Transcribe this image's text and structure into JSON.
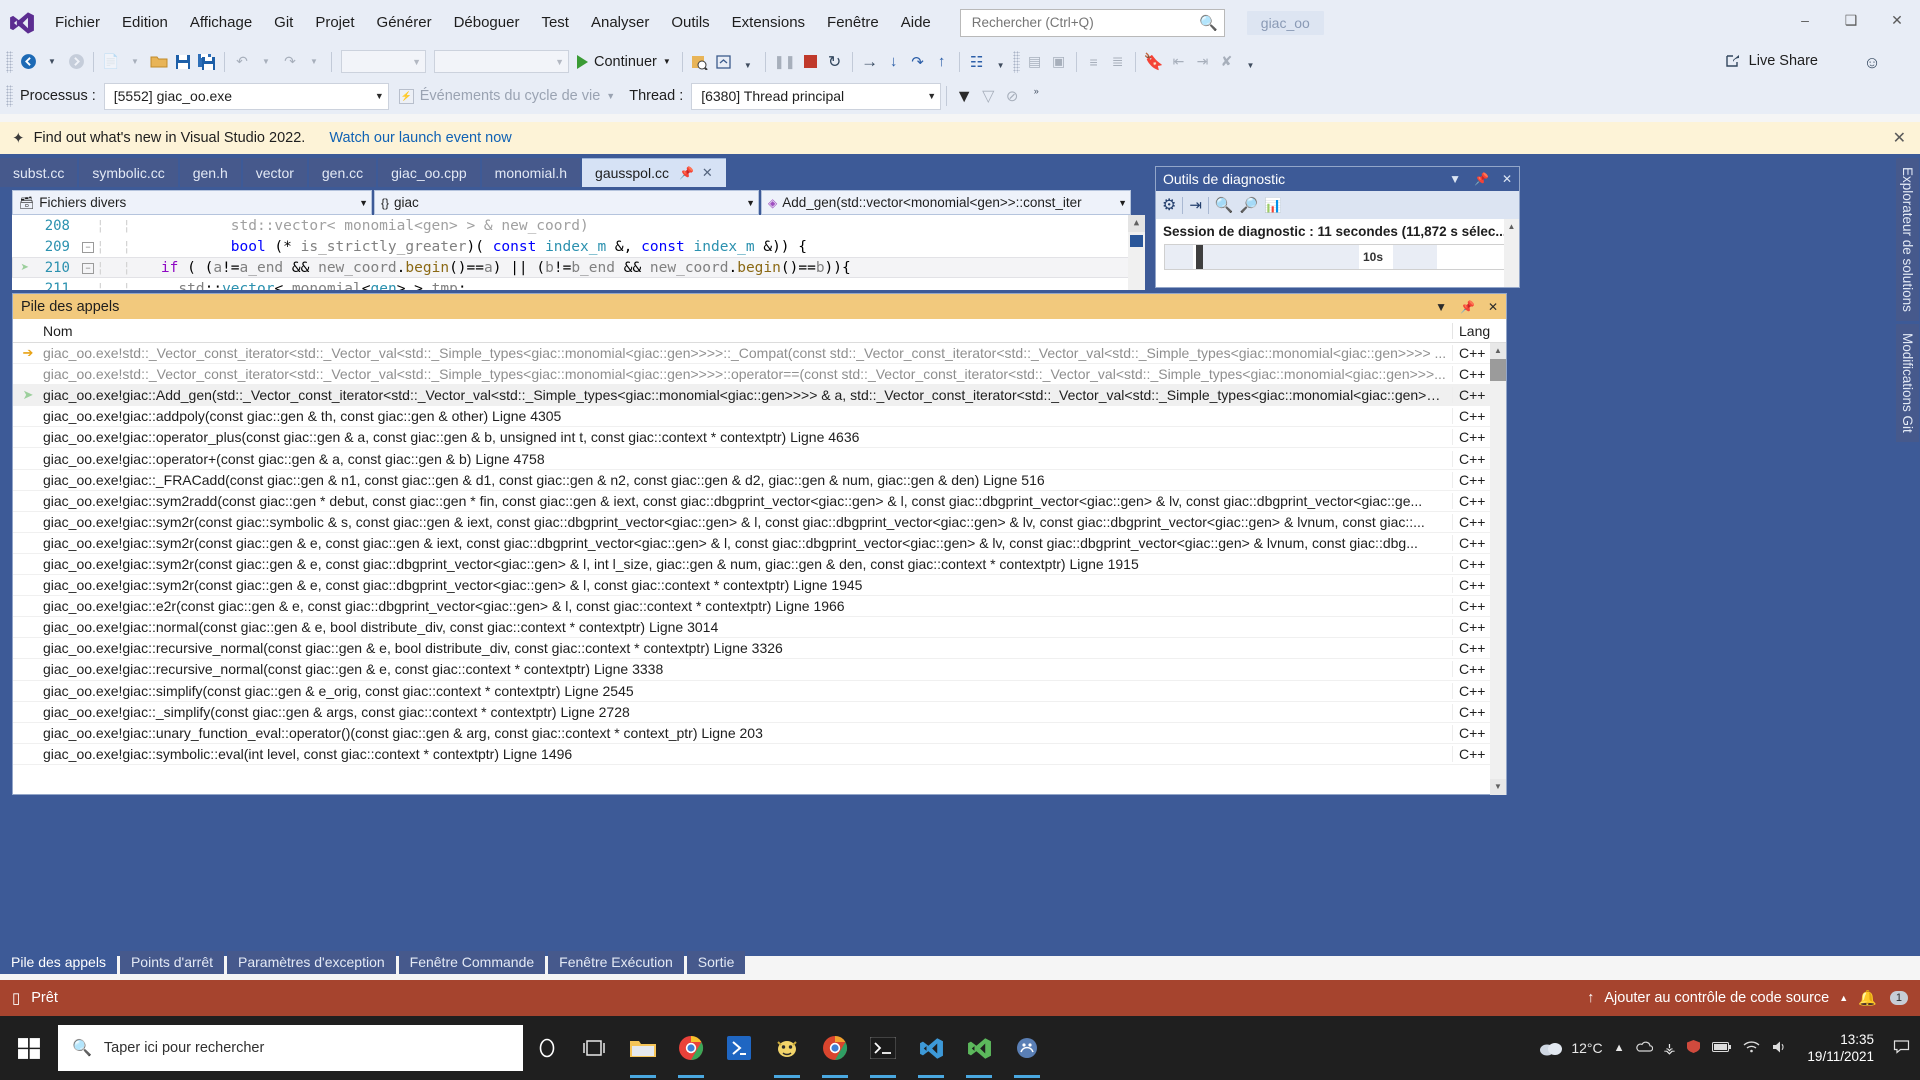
{
  "titlebar": {
    "app_icon": "visual-studio-logo",
    "menus": [
      "Fichier",
      "Edition",
      "Affichage",
      "Git",
      "Projet",
      "Générer",
      "Déboguer",
      "Test",
      "Analyser",
      "Outils",
      "Extensions",
      "Fenêtre",
      "Aide"
    ],
    "search_placeholder": "Rechercher (Ctrl+Q)",
    "search_value": "",
    "solution_name": "giac_oo",
    "minimize": "minimize-icon",
    "restore": "restore-icon",
    "close": "close-icon"
  },
  "toolbar": {
    "continue_label": "Continuer",
    "live_share_label": "Live Share",
    "nav_back": "navigate-back",
    "nav_forward": "navigate-forward",
    "new_item": "new-item",
    "open_file": "open-file",
    "save": "save",
    "save_all": "save-all",
    "undo": "undo",
    "redo": "redo"
  },
  "debugbar": {
    "process_label": "Processus :",
    "process_value": "[5552] giac_oo.exe",
    "lifecycle_label": "Événements du cycle de vie",
    "thread_label": "Thread :",
    "thread_value": "[6380] Thread principal"
  },
  "notice": {
    "text": "Find out what's new in Visual Studio 2022.",
    "link": "Watch our launch event now",
    "close": "close-icon"
  },
  "tabs": {
    "items": [
      "subst.cc",
      "symbolic.cc",
      "gen.h",
      "vector",
      "gen.cc",
      "giac_oo.cpp",
      "monomial.h"
    ],
    "active": "gausspol.cc"
  },
  "navbar": {
    "project": "Fichiers divers",
    "namespace": "giac",
    "member": "Add_gen(std::vector<monomial<gen>>::const_iter"
  },
  "editor": {
    "lines": [
      {
        "number": "208",
        "current": false,
        "tokens": [
          {
            "t": "            ",
            "c": "k-black"
          },
          {
            "t": "std::vector< monomial<gen> > & new_coord)",
            "c": "k-gray"
          }
        ]
      },
      {
        "number": "209",
        "current": false,
        "fold": "-",
        "tokens": [
          {
            "t": "            ",
            "c": "k-black"
          },
          {
            "t": "bool",
            "c": "k-blue"
          },
          {
            "t": " (* ",
            "c": "k-black"
          },
          {
            "t": "is_strictly_greater",
            "c": "k-dgray"
          },
          {
            "t": ")( ",
            "c": "k-black"
          },
          {
            "t": "const",
            "c": "k-blue"
          },
          {
            "t": " ",
            "c": "k-black"
          },
          {
            "t": "index_m",
            "c": "k-teal"
          },
          {
            "t": " &, ",
            "c": "k-black"
          },
          {
            "t": "const",
            "c": "k-blue"
          },
          {
            "t": " ",
            "c": "k-black"
          },
          {
            "t": "index_m",
            "c": "k-teal"
          },
          {
            "t": " &)) {",
            "c": "k-black"
          }
        ]
      },
      {
        "number": "210",
        "current": true,
        "fold": "-",
        "indicator": "current-statement",
        "tokens": [
          {
            "t": "    ",
            "c": "k-black"
          },
          {
            "t": "if",
            "c": "k-purple"
          },
          {
            "t": " ( (",
            "c": "k-black"
          },
          {
            "t": "a",
            "c": "k-dgray"
          },
          {
            "t": "!=",
            "c": "k-black"
          },
          {
            "t": "a_end",
            "c": "k-dgray"
          },
          {
            "t": " && ",
            "c": "k-black"
          },
          {
            "t": "new_coord",
            "c": "k-dgray"
          },
          {
            "t": ".",
            "c": "k-black"
          },
          {
            "t": "begin",
            "c": "k-brown"
          },
          {
            "t": "()",
            "c": "k-black"
          },
          {
            "t": "==",
            "c": "k-black"
          },
          {
            "t": "a",
            "c": "k-dgray"
          },
          {
            "t": ") || (",
            "c": "k-black"
          },
          {
            "t": "b",
            "c": "k-dgray"
          },
          {
            "t": "!=",
            "c": "k-black"
          },
          {
            "t": "b_end",
            "c": "k-dgray"
          },
          {
            "t": " && ",
            "c": "k-black"
          },
          {
            "t": "new_coord",
            "c": "k-dgray"
          },
          {
            "t": ".",
            "c": "k-black"
          },
          {
            "t": "begin",
            "c": "k-brown"
          },
          {
            "t": "()",
            "c": "k-black"
          },
          {
            "t": "==",
            "c": "k-black"
          },
          {
            "t": "b",
            "c": "k-dgray"
          },
          {
            "t": ")){",
            "c": "k-black"
          }
        ]
      },
      {
        "number": "211",
        "current": false,
        "tokens": [
          {
            "t": "      ",
            "c": "k-black"
          },
          {
            "t": "std",
            "c": "k-dgray"
          },
          {
            "t": "::",
            "c": "k-black"
          },
          {
            "t": "vector",
            "c": "k-teal"
          },
          {
            "t": "< ",
            "c": "k-black"
          },
          {
            "t": "monomial",
            "c": "k-dgray"
          },
          {
            "t": "<",
            "c": "k-black"
          },
          {
            "t": "gen",
            "c": "k-teal"
          },
          {
            "t": "> > ",
            "c": "k-black"
          },
          {
            "t": "tmp",
            "c": "k-dgray"
          },
          {
            "t": ";",
            "c": "k-black"
          }
        ]
      }
    ]
  },
  "callstack": {
    "title": "Pile des appels",
    "columns": [
      "Nom",
      "Lang"
    ],
    "rows": [
      {
        "indicator": "current-arrow",
        "dim": true,
        "name": "giac_oo.exe!std::_Vector_const_iterator<std::_Vector_val<std::_Simple_types<giac::monomial<giac::gen>>>>::_Compat(const std::_Vector_const_iterator<std::_Vector_val<std::_Simple_types<giac::monomial<giac::gen>>>> ...",
        "lang": "C++"
      },
      {
        "indicator": "",
        "dim": true,
        "name": "giac_oo.exe!std::_Vector_const_iterator<std::_Vector_val<std::_Simple_types<giac::monomial<giac::gen>>>>::operator==(const std::_Vector_const_iterator<std::_Vector_val<std::_Simple_types<giac::monomial<giac::gen>>>...",
        "lang": "C++"
      },
      {
        "indicator": "current-statement",
        "dim": false,
        "highlight": true,
        "name": "giac_oo.exe!giac::Add_gen(std::_Vector_const_iterator<std::_Vector_val<std::_Simple_types<giac::monomial<giac::gen>>>> & a, std::_Vector_const_iterator<std::_Vector_val<std::_Simple_types<giac::monomial<giac::gen>>>...",
        "lang": "C++"
      },
      {
        "indicator": "",
        "dim": false,
        "name": "giac_oo.exe!giac::addpoly(const giac::gen & th, const giac::gen & other) Ligne 4305",
        "lang": "C++"
      },
      {
        "indicator": "",
        "dim": false,
        "name": "giac_oo.exe!giac::operator_plus(const giac::gen & a, const giac::gen & b, unsigned int t, const giac::context * contextptr) Ligne 4636",
        "lang": "C++"
      },
      {
        "indicator": "",
        "dim": false,
        "name": "giac_oo.exe!giac::operator+(const giac::gen & a, const giac::gen & b) Ligne 4758",
        "lang": "C++"
      },
      {
        "indicator": "",
        "dim": false,
        "name": "giac_oo.exe!giac::_FRACadd(const giac::gen & n1, const giac::gen & d1, const giac::gen & n2, const giac::gen & d2, giac::gen & num, giac::gen & den) Ligne 516",
        "lang": "C++"
      },
      {
        "indicator": "",
        "dim": false,
        "name": "giac_oo.exe!giac::sym2radd(const giac::gen * debut, const giac::gen * fin, const giac::gen & iext, const giac::dbgprint_vector<giac::gen> & l, const giac::dbgprint_vector<giac::gen> & lv, const giac::dbgprint_vector<giac::ge...",
        "lang": "C++"
      },
      {
        "indicator": "",
        "dim": false,
        "name": "giac_oo.exe!giac::sym2r(const giac::symbolic & s, const giac::gen & iext, const giac::dbgprint_vector<giac::gen> & l, const giac::dbgprint_vector<giac::gen> & lv, const giac::dbgprint_vector<giac::gen> & lvnum, const giac::...",
        "lang": "C++"
      },
      {
        "indicator": "",
        "dim": false,
        "name": "giac_oo.exe!giac::sym2r(const giac::gen & e, const giac::gen & iext, const giac::dbgprint_vector<giac::gen> & l, const giac::dbgprint_vector<giac::gen> & lv, const giac::dbgprint_vector<giac::gen> & lvnum, const giac::dbg...",
        "lang": "C++"
      },
      {
        "indicator": "",
        "dim": false,
        "name": "giac_oo.exe!giac::sym2r(const giac::gen & e, const giac::dbgprint_vector<giac::gen> & l, int l_size, giac::gen & num, giac::gen & den, const giac::context * contextptr) Ligne 1915",
        "lang": "C++"
      },
      {
        "indicator": "",
        "dim": false,
        "name": "giac_oo.exe!giac::sym2r(const giac::gen & e, const giac::dbgprint_vector<giac::gen> & l, const giac::context * contextptr) Ligne 1945",
        "lang": "C++"
      },
      {
        "indicator": "",
        "dim": false,
        "name": "giac_oo.exe!giac::e2r(const giac::gen & e, const giac::dbgprint_vector<giac::gen> & l, const giac::context * contextptr) Ligne 1966",
        "lang": "C++"
      },
      {
        "indicator": "",
        "dim": false,
        "name": "giac_oo.exe!giac::normal(const giac::gen & e, bool distribute_div, const giac::context * contextptr) Ligne 3014",
        "lang": "C++"
      },
      {
        "indicator": "",
        "dim": false,
        "name": "giac_oo.exe!giac::recursive_normal(const giac::gen & e, bool distribute_div, const giac::context * contextptr) Ligne 3326",
        "lang": "C++"
      },
      {
        "indicator": "",
        "dim": false,
        "name": "giac_oo.exe!giac::recursive_normal(const giac::gen & e, const giac::context * contextptr) Ligne 3338",
        "lang": "C++"
      },
      {
        "indicator": "",
        "dim": false,
        "name": "giac_oo.exe!giac::simplify(const giac::gen & e_orig, const giac::context * contextptr) Ligne 2545",
        "lang": "C++"
      },
      {
        "indicator": "",
        "dim": false,
        "name": "giac_oo.exe!giac::_simplify(const giac::gen & args, const giac::context * contextptr) Ligne 2728",
        "lang": "C++"
      },
      {
        "indicator": "",
        "dim": false,
        "name": "giac_oo.exe!giac::unary_function_eval::operator()(const giac::gen & arg, const giac::context * context_ptr) Ligne 203",
        "lang": "C++"
      },
      {
        "indicator": "",
        "dim": false,
        "name": "giac_oo.exe!giac::symbolic::eval(int level, const giac::context * contextptr) Ligne 1496",
        "lang": "C++"
      }
    ]
  },
  "diagnostics": {
    "title": "Outils de diagnostic",
    "session_text": "Session de diagnostic : 11 secondes (11,872 s sélec...",
    "timeline_label": "10s",
    "toolbar_icons": [
      "gear-icon",
      "export-icon",
      "zoom-in-icon",
      "zoom-out-icon",
      "chart-icon"
    ]
  },
  "vertical_tabs": [
    "Explorateur de solutions",
    "Modifications Git"
  ],
  "bottom_tabs": {
    "items": [
      "Pile des appels",
      "Points d'arrêt",
      "Paramètres d'exception",
      "Fenêtre Commande",
      "Fenêtre Exécution",
      "Sortie"
    ],
    "active": "Pile des appels"
  },
  "statusbar": {
    "state": "Prêt",
    "source_control": "Ajouter au contrôle de code source",
    "notification_count": "1"
  },
  "taskbar": {
    "search_placeholder": "Taper ici pour rechercher",
    "weather_temp": "12°C",
    "time": "13:35",
    "date": "19/11/2021",
    "apps": [
      "cortana-icon",
      "task-view-icon",
      "file-explorer-icon",
      "chrome-icon",
      "powershell-icon",
      "xaringan-icon",
      "chrome-canary-icon",
      "terminal-icon",
      "vscode-icon",
      "vscode-insiders-icon",
      "giac-icon"
    ]
  },
  "colors": {
    "title_bg": "#e8edf6",
    "chrome_blue": "#3d5a97",
    "tab_inactive": "#46598c",
    "notice_bg": "#fdf3d7",
    "callstack_title": "#f2c97d",
    "status_bg": "#a6442e",
    "accent_link": "#1062b4"
  }
}
